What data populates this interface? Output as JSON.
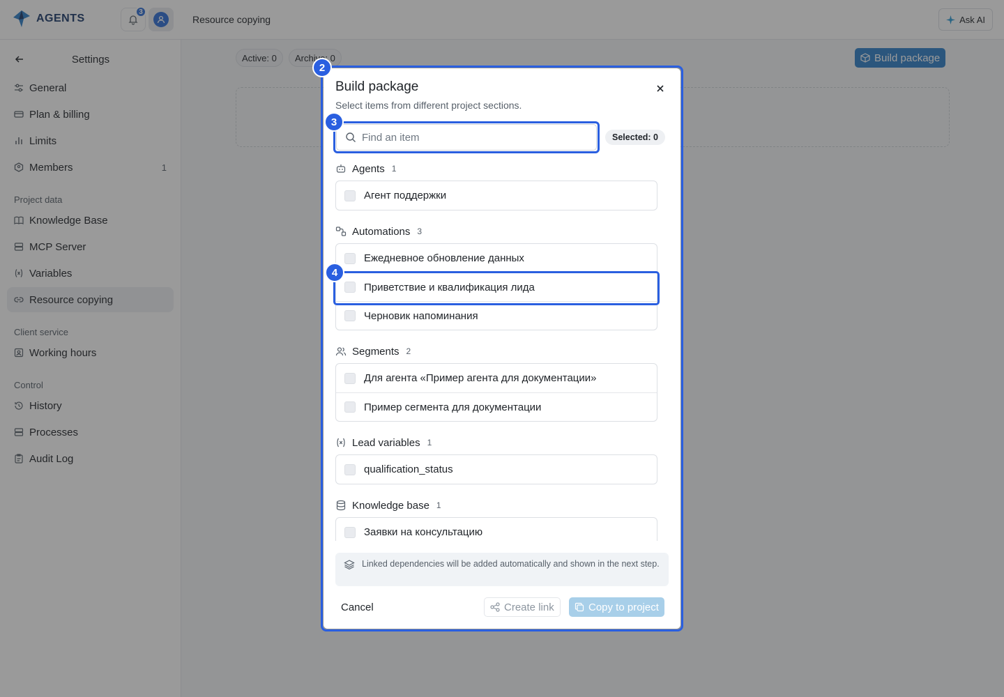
{
  "app": {
    "logo_text": "AGENTS",
    "notifications_count": "3",
    "page_title": "Resource copying",
    "ask_ai_label": "Ask AI",
    "accent_color": "#2f6fd6"
  },
  "sidebar": {
    "title": "Settings",
    "items_top": [
      {
        "label": "General",
        "icon": "sliders-icon"
      },
      {
        "label": "Plan & billing",
        "icon": "credit-card-icon"
      },
      {
        "label": "Limits",
        "icon": "bar-chart-icon"
      },
      {
        "label": "Members",
        "icon": "users-icon",
        "count": "1"
      }
    ],
    "section_project": "Project data",
    "items_project": [
      {
        "label": "Knowledge Base",
        "icon": "book-icon"
      },
      {
        "label": "MCP Server",
        "icon": "server-icon"
      },
      {
        "label": "Variables",
        "icon": "variable-icon"
      },
      {
        "label": "Resource copying",
        "icon": "link-icon",
        "active": true
      }
    ],
    "section_client": "Client service",
    "items_client": [
      {
        "label": "Working hours",
        "icon": "clock-icon"
      }
    ],
    "section_control": "Control",
    "items_control": [
      {
        "label": "History",
        "icon": "history-icon"
      },
      {
        "label": "Processes",
        "icon": "list-icon"
      },
      {
        "label": "Audit Log",
        "icon": "clipboard-icon"
      }
    ]
  },
  "main": {
    "active_label": "Active: 0",
    "archive_label": "Archive: 0",
    "build_button": "Build package"
  },
  "modal": {
    "title": "Build package",
    "subtitle": "Select items from different project sections.",
    "search_placeholder": "Find an item",
    "selected_label": "Selected: 0",
    "groups": [
      {
        "name": "Agents",
        "count": "1",
        "icon": "robot-icon",
        "items": [
          "Агент поддержки"
        ]
      },
      {
        "name": "Automations",
        "count": "3",
        "icon": "workflow-icon",
        "items": [
          "Ежедневное обновление данных",
          "Приветствие и квалификация лида",
          "Черновик напоминания"
        ]
      },
      {
        "name": "Segments",
        "count": "2",
        "icon": "users-icon",
        "items": [
          "Для агента «Пример агента для документации»",
          "Пример сегмента для документации"
        ]
      },
      {
        "name": "Lead variables",
        "count": "1",
        "icon": "variable-icon",
        "items": [
          "qualification_status"
        ]
      },
      {
        "name": "Knowledge base",
        "count": "1",
        "icon": "database-icon",
        "items": [
          "Заявки на консультацию"
        ]
      }
    ],
    "info_text": "Linked dependencies will be added automatically and shown in the next step.",
    "cancel_label": "Cancel",
    "create_link_label": "Create link",
    "copy_label": "Copy to project"
  },
  "markers": [
    "2",
    "3",
    "4"
  ]
}
